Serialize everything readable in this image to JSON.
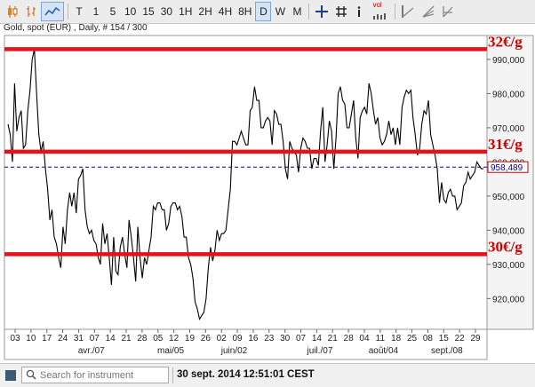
{
  "toolbar": {
    "chart_type_icons": [
      "candlestick-chart-icon",
      "bar-chart-icon",
      "line-chart-icon"
    ],
    "timeframes": [
      "T",
      "1",
      "5",
      "10",
      "15",
      "30",
      "1H",
      "2H",
      "4H",
      "8H",
      "D",
      "W",
      "M"
    ],
    "active_timeframe": "D",
    "tool_icons": [
      "crosshair-icon",
      "grid-icon",
      "info-icon",
      "volume-icon",
      "drawing-trend-icon",
      "fibonacci-icon",
      "more-tools-icon"
    ],
    "volume_label": "vol"
  },
  "chart_info": "Gold, spot (EUR) , Daily, # 154 / 300",
  "status": {
    "search_placeholder": "Search for instrument",
    "datetime": "30 sept. 2014 12:51:01 CEST"
  },
  "colors": {
    "price_line": "#000000",
    "annotation": "#e8101a",
    "annotation_text": "#cc0000",
    "current_price": "#0000aa"
  },
  "chart_data": {
    "type": "line",
    "series": [
      {
        "values": [
          971,
          968,
          960,
          983,
          969,
          973,
          975,
          964,
          965,
          975,
          981,
          990,
          993,
          980,
          968,
          963,
          966,
          958,
          952,
          943,
          946,
          938,
          936,
          932,
          929,
          941,
          936,
          946,
          951,
          947,
          951,
          945,
          955,
          956,
          958,
          946,
          941,
          939,
          940,
          937,
          936,
          932,
          930,
          942,
          936,
          939,
          932,
          924,
          938,
          928,
          927,
          935,
          938,
          933,
          929,
          943,
          938,
          932,
          925,
          941,
          932,
          926,
          932,
          930,
          934,
          938,
          947,
          946,
          948,
          948,
          946,
          946,
          940,
          942,
          947,
          948,
          948,
          946,
          947,
          944,
          938,
          938,
          932,
          930,
          926,
          919,
          917,
          914,
          915,
          916,
          920,
          929,
          935,
          931,
          934,
          940,
          937,
          939,
          939,
          940,
          946,
          952,
          966,
          966,
          965,
          967,
          969,
          967,
          965,
          965,
          975,
          976,
          982,
          978,
          978,
          970,
          970,
          972,
          973,
          972,
          965,
          975,
          974,
          971,
          971,
          966,
          958,
          955,
          966,
          964,
          963,
          962,
          957,
          964,
          967,
          966,
          964,
          964,
          958,
          961,
          961,
          959,
          969,
          976,
          960,
          965,
          972,
          969,
          958,
          967,
          980,
          982,
          978,
          977,
          970,
          970,
          974,
          978,
          967,
          961,
          973,
          975,
          976,
          974,
          983,
          980,
          975,
          971,
          973,
          967,
          965,
          966,
          968,
          972,
          968,
          970,
          965,
          970,
          965,
          976,
          979,
          981,
          980,
          981,
          973,
          968,
          962,
          964,
          971,
          975,
          974,
          978,
          968,
          965,
          962,
          958,
          948,
          954,
          949,
          948,
          951,
          952,
          950,
          950,
          946,
          947,
          948,
          953,
          954,
          957,
          955,
          956,
          957,
          960,
          959,
          958,
          958
        ]
      }
    ],
    "x_tick_labels": [
      "03",
      "10",
      "17",
      "24",
      "31",
      "07",
      "14",
      "21",
      "28",
      "05",
      "12",
      "19",
      "26",
      "02",
      "09",
      "16",
      "23",
      "30",
      "07",
      "14",
      "21",
      "28",
      "04",
      "11",
      "18",
      "25",
      "08",
      "15",
      "22",
      "29"
    ],
    "x_month_labels": [
      "avr./07",
      "mai/05",
      "juin/02",
      "juil./07",
      "août/04",
      "sept./08"
    ],
    "y_tick_labels": [
      "920,000",
      "930,000",
      "940,000",
      "950,000",
      "960,000",
      "970,000",
      "980,000",
      "990,000"
    ],
    "ylim": [
      911,
      997
    ],
    "current_price_label": "958,489",
    "annotations": [
      {
        "label": "32€/g",
        "value": 993
      },
      {
        "label": "31€/g",
        "value": 963
      },
      {
        "label": "30€/g",
        "value": 933
      }
    ]
  }
}
